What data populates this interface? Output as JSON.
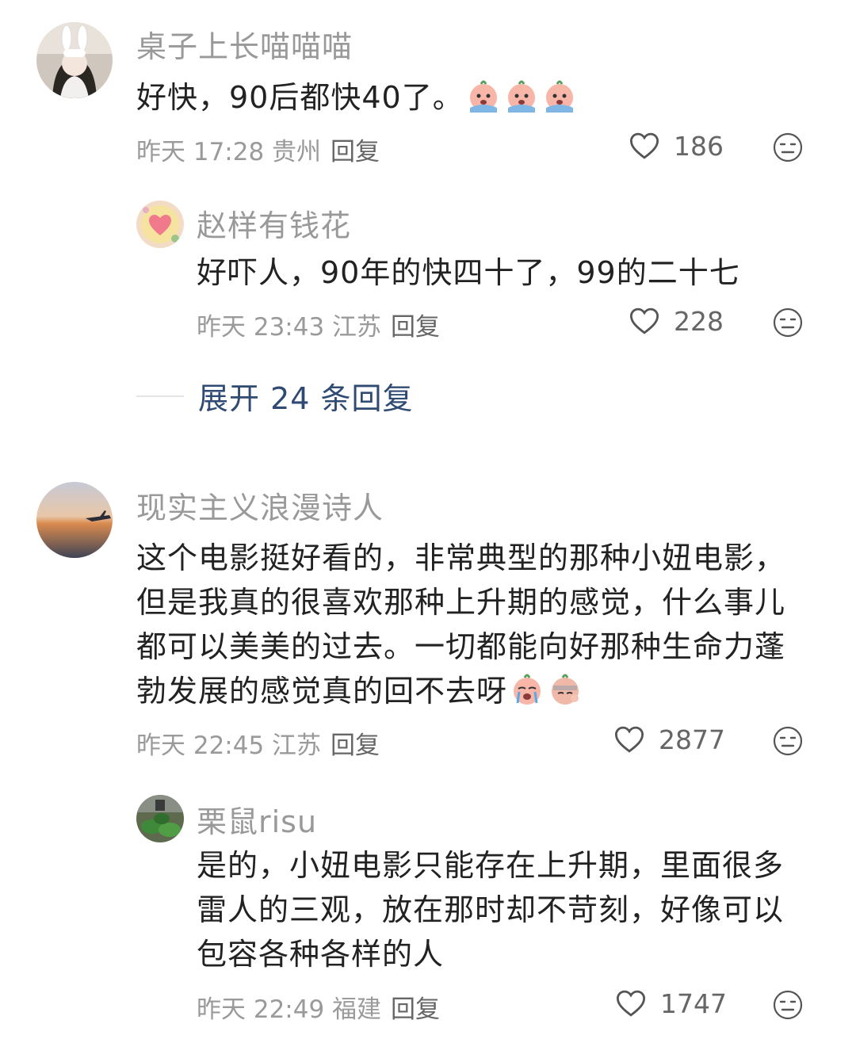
{
  "comments": [
    {
      "username": "桌子上长喵喵喵",
      "text": "好快，90后都快40了。",
      "emojis": [
        "crying-peach-emoji",
        "crying-peach-emoji",
        "crying-peach-emoji"
      ],
      "meta": "昨天 17:28 贵州",
      "reply_label": "回复",
      "likes": "186",
      "replies": [
        {
          "username": "赵样有钱花",
          "text": "好吓人，90年的快四十了，99的二十七",
          "meta": "昨天 23:43 江苏",
          "reply_label": "回复",
          "likes": "228"
        }
      ],
      "expand_label": "展开 24 条回复"
    },
    {
      "username": "现实主义浪漫诗人",
      "text": "这个电影挺好看的，非常典型的那种小妞电影，但是我真的很喜欢那种上升期的感觉，什么事儿都可以美美的过去。一切都能向好那种生命力蓬勃发展的感觉真的回不去呀",
      "emojis": [
        "crying-peach-emoji",
        "sad-peach-emoji"
      ],
      "meta": "昨天 22:45 江苏",
      "reply_label": "回复",
      "likes": "2877",
      "replies": [
        {
          "username": "栗鼠risu",
          "text": "是的，小妞电影只能存在上升期，里面很多雷人的三观，放在那时却不苛刻，好像可以包容各种各样的人",
          "meta": "昨天 22:49 福建",
          "reply_label": "回复",
          "likes": "1747"
        }
      ]
    }
  ],
  "colors": {
    "name": "#999999",
    "text": "#222222",
    "meta": "#9a9a9a",
    "expand": "#2f4a73"
  },
  "icons": [
    "heart-outline-icon",
    "dislike-face-icon"
  ]
}
